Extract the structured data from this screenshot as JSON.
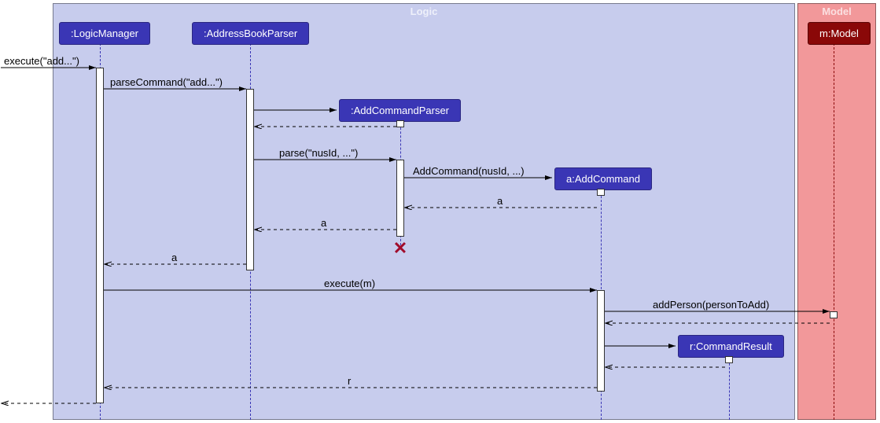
{
  "frames": {
    "logic": {
      "label": "Logic"
    },
    "model": {
      "label": "Model"
    }
  },
  "participants": {
    "logicManager": ":LogicManager",
    "addressBookParser": ":AddressBookParser",
    "addCommandParser": ":AddCommandParser",
    "addCommand": "a:AddCommand",
    "commandResult": "r:CommandResult",
    "model": "m:Model"
  },
  "messages": {
    "execute_add": "execute(\"add...\")",
    "parseCommand": "parseCommand(\"add...\")",
    "parse": "parse(\"nusId, ...\")",
    "addCommand_ctor": "AddCommand(nusId, ...)",
    "return_a1": "a",
    "return_a2": "a",
    "return_a3": "a",
    "execute_m": "execute(m)",
    "addPerson": "addPerson(personToAdd)",
    "return_r": "r"
  },
  "chart_data": {
    "type": "sequence-diagram",
    "frames": [
      {
        "name": "Logic",
        "participants": [
          ":LogicManager",
          ":AddressBookParser",
          ":AddCommandParser",
          "a:AddCommand",
          "r:CommandResult"
        ]
      },
      {
        "name": "Model",
        "participants": [
          "m:Model"
        ]
      }
    ],
    "lifelines": [
      ":LogicManager",
      ":AddressBookParser",
      ":AddCommandParser",
      "a:AddCommand",
      "r:CommandResult",
      "m:Model"
    ],
    "interactions": [
      {
        "from": "external",
        "to": ":LogicManager",
        "label": "execute(\"add...\")",
        "type": "sync"
      },
      {
        "from": ":LogicManager",
        "to": ":AddressBookParser",
        "label": "parseCommand(\"add...\")",
        "type": "sync"
      },
      {
        "from": ":AddressBookParser",
        "to": ":AddCommandParser",
        "label": "",
        "type": "create"
      },
      {
        "from": ":AddCommandParser",
        "to": ":AddressBookParser",
        "label": "",
        "type": "return"
      },
      {
        "from": ":AddressBookParser",
        "to": ":AddCommandParser",
        "label": "parse(\"nusId, ...\")",
        "type": "sync"
      },
      {
        "from": ":AddCommandParser",
        "to": "a:AddCommand",
        "label": "AddCommand(nusId, ...)",
        "type": "create"
      },
      {
        "from": "a:AddCommand",
        "to": ":AddCommandParser",
        "label": "a",
        "type": "return"
      },
      {
        "from": ":AddCommandParser",
        "to": ":AddressBookParser",
        "label": "a",
        "type": "return"
      },
      {
        "from": ":AddCommandParser",
        "to": null,
        "label": "",
        "type": "destroy"
      },
      {
        "from": ":AddressBookParser",
        "to": ":LogicManager",
        "label": "a",
        "type": "return"
      },
      {
        "from": ":LogicManager",
        "to": "a:AddCommand",
        "label": "execute(m)",
        "type": "sync"
      },
      {
        "from": "a:AddCommand",
        "to": "m:Model",
        "label": "addPerson(personToAdd)",
        "type": "sync"
      },
      {
        "from": "m:Model",
        "to": "a:AddCommand",
        "label": "",
        "type": "return"
      },
      {
        "from": "a:AddCommand",
        "to": "r:CommandResult",
        "label": "",
        "type": "create"
      },
      {
        "from": "r:CommandResult",
        "to": "a:AddCommand",
        "label": "",
        "type": "return"
      },
      {
        "from": "a:AddCommand",
        "to": ":LogicManager",
        "label": "r",
        "type": "return"
      },
      {
        "from": ":LogicManager",
        "to": "external",
        "label": "",
        "type": "return"
      }
    ]
  }
}
